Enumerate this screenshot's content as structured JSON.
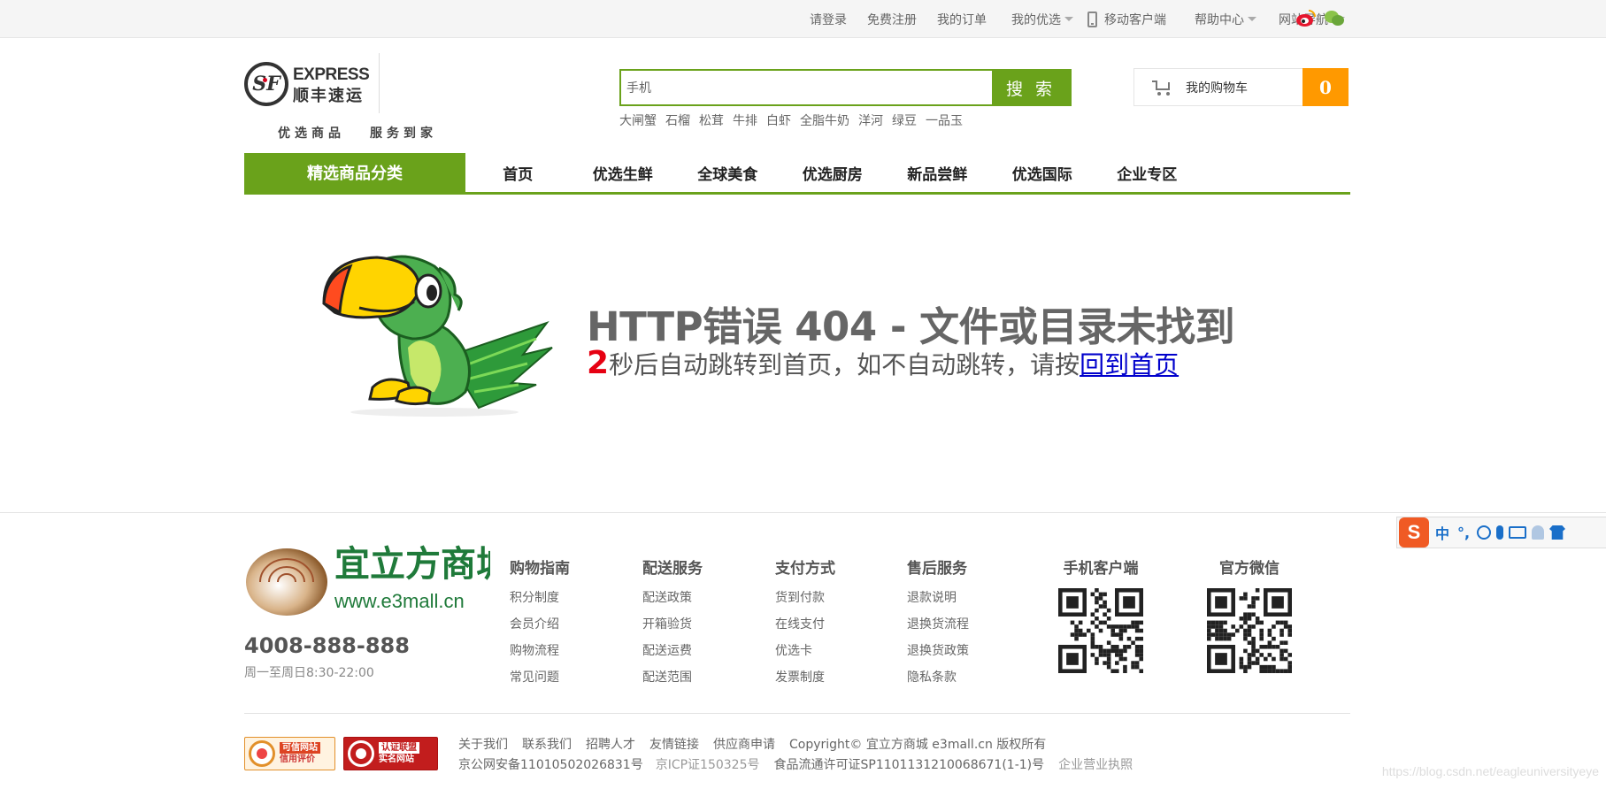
{
  "topbar": {
    "login": "请登录",
    "register": "免费注册",
    "orders": "我的订单",
    "my_youxuan": "我的优选",
    "mobile_client": "移动客户端",
    "help_center": "帮助中心",
    "site_nav": "网站导航"
  },
  "header": {
    "logo_en": "EXPRESS",
    "logo_cn": "顺丰速运",
    "slogan_left": "优选商品",
    "slogan_right": "服务到家",
    "search_value": "手机",
    "search_button": "搜 索",
    "hot_words": [
      "大闸蟹",
      "石榴",
      "松茸",
      "牛排",
      "白虾",
      "全脂牛奶",
      "洋河",
      "绿豆",
      "一品玉"
    ],
    "cart_label": "我的购物车",
    "cart_count": "0"
  },
  "nav": {
    "category": "精选商品分类",
    "items": [
      "首页",
      "优选生鲜",
      "全球美食",
      "优选厨房",
      "新品尝鲜",
      "优选国际",
      "企业专区"
    ]
  },
  "error": {
    "title": "HTTP错误 404 - 文件或目录未找到",
    "countdown": "2",
    "message": "秒后自动跳转到首页，如不自动跳转，请按",
    "home_link": "回到首页"
  },
  "footer": {
    "mall_name": "宜立方商城",
    "mall_url": "www.e3mall.cn",
    "phone": "4008-888-888",
    "hours": "周一至周日8:30-22:00",
    "columns": [
      {
        "title": "购物指南",
        "links": [
          "积分制度",
          "会员介绍",
          "购物流程",
          "常见问题"
        ]
      },
      {
        "title": "配送服务",
        "links": [
          "配送政策",
          "开箱验货",
          "配送运费",
          "配送范围"
        ]
      },
      {
        "title": "支付方式",
        "links": [
          "货到付款",
          "在线支付",
          "优选卡",
          "发票制度"
        ]
      },
      {
        "title": "售后服务",
        "links": [
          "退款说明",
          "退换货流程",
          "退换货政策",
          "隐私条款"
        ]
      }
    ],
    "qr_mobile_title": "手机客户端",
    "qr_wechat_title": "官方微信",
    "badge1_line1": "可信网站",
    "badge1_line2": "信用评价",
    "badge2_line1": "认证联盟",
    "badge2_line2": "实名网站",
    "links": [
      "关于我们",
      "联系我们",
      "招聘人才",
      "友情链接",
      "供应商申请"
    ],
    "copyright": "Copyright© 宜立方商城 e3mall.cn 版权所有",
    "icp1": "京公网安备11010502026831号",
    "icp2": "京ICP证150325号",
    "food_license": "食品流通许可证SP1101131210068671(1-1)号",
    "business_license": "企业营业执照",
    "watermark": "https://blog.csdn.net/eagleuniversityeye"
  },
  "ime": {
    "logo": "S",
    "mode": "中",
    "punct": "°,"
  },
  "colors": {
    "brand_green": "#6aa21b",
    "cart_orange": "#ff9900",
    "countdown_red": "#e60012",
    "link_blue": "#0000cc"
  }
}
